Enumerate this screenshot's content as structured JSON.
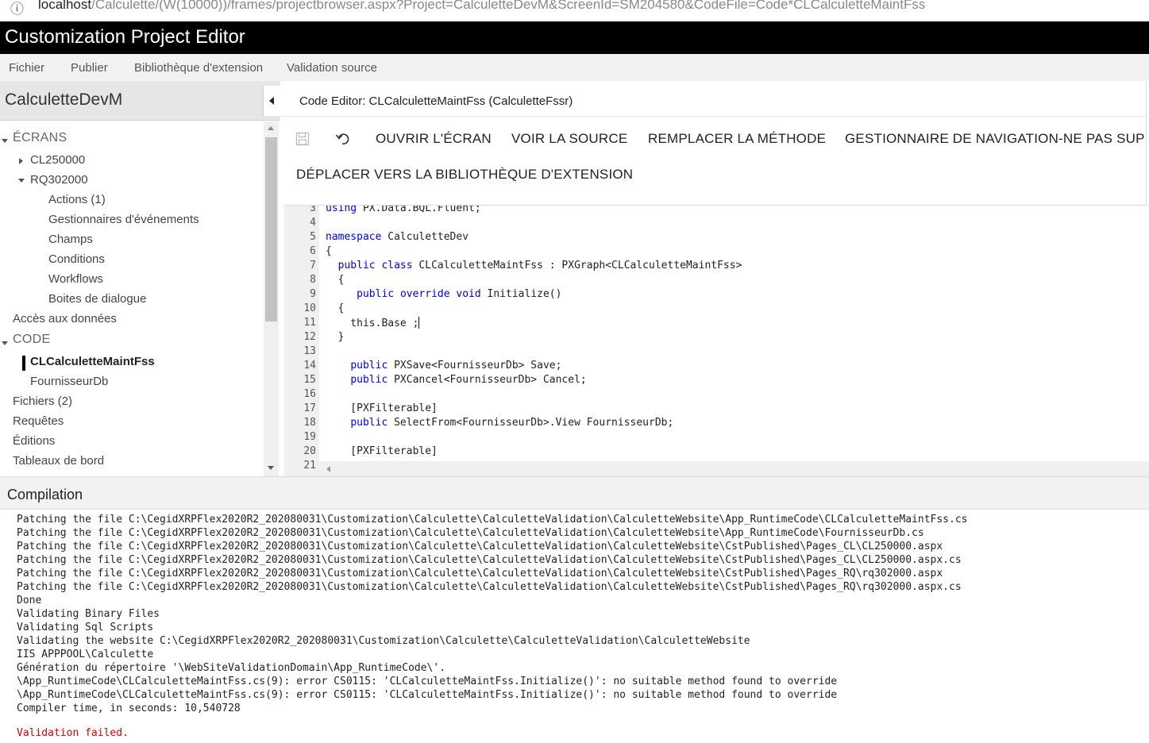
{
  "browser": {
    "info_icon": "info-icon",
    "url_host": "localhost",
    "url_path": "/Calculette/(W(10000))/frames/projectbrowser.aspx?Project=CalculetteDevM&ScreenId=SM204580&CodeFile=Code*CLCalculetteMaintFss"
  },
  "app": {
    "title": "Customization Project Editor"
  },
  "menu": {
    "fichier": "Fichier",
    "publier": "Publier",
    "bibliotheque": "Bibliothèque d'extension",
    "validation": "Validation source"
  },
  "project": {
    "name": "CalculetteDevM"
  },
  "tree": {
    "ecrans": "ÉCRANS",
    "cl250000": "CL250000",
    "rq302000": "RQ302000",
    "actions": "Actions (1)",
    "gestionnaires": "Gestionnaires d'événements",
    "champs": "Champs",
    "conditions": "Conditions",
    "workflows": "Workflows",
    "boites": "Boites de dialogue",
    "acces": "Accès aux données",
    "code": "CODE",
    "clcalc": "CLCalculetteMaintFss",
    "fournisseur": "FournisseurDb",
    "fichiers": "Fichiers (2)",
    "requetes": "Requêtes",
    "editions": "Éditions",
    "tableaux": "Tableaux de bord"
  },
  "editor": {
    "title": "Code Editor: CLCalculetteMaintFss (CalculetteFssr)",
    "toolbar": {
      "save_icon": "save-icon",
      "undo_icon": "undo-icon",
      "ouvrir": "OUVRIR L'ÉCRAN",
      "voir": "VOIR LA SOURCE",
      "remplacer": "REMPLACER LA MÉTHODE",
      "gestionnaire": "GESTIONNAIRE DE NAVIGATION-NE PAS SUPPRIMER",
      "deplacer": "DÉPLACER VERS LA BIBLIOTHÈQUE D'EXTENSION"
    },
    "line_numbers": [
      "3",
      "4",
      "5",
      "6",
      "7",
      "8",
      "9",
      "10",
      "11",
      "12",
      "13",
      "14",
      "15",
      "16",
      "17",
      "18",
      "19",
      "20",
      "21"
    ]
  },
  "compilation": {
    "title": "Compilation",
    "log": [
      "Patching the file C:\\CegidXRPFlex2020R2_202080031\\Customization\\Calculette\\CalculetteValidation\\CalculetteWebsite\\App_RuntimeCode\\CLCalculetteMaintFss.cs",
      "Patching the file C:\\CegidXRPFlex2020R2_202080031\\Customization\\Calculette\\CalculetteValidation\\CalculetteWebsite\\App_RuntimeCode\\FournisseurDb.cs",
      "Patching the file C:\\CegidXRPFlex2020R2_202080031\\Customization\\Calculette\\CalculetteValidation\\CalculetteWebsite\\CstPublished\\Pages_CL\\CL250000.aspx",
      "Patching the file C:\\CegidXRPFlex2020R2_202080031\\Customization\\Calculette\\CalculetteValidation\\CalculetteWebsite\\CstPublished\\Pages_CL\\CL250000.aspx.cs",
      "Patching the file C:\\CegidXRPFlex2020R2_202080031\\Customization\\Calculette\\CalculetteValidation\\CalculetteWebsite\\CstPublished\\Pages_RQ\\rq302000.aspx",
      "Patching the file C:\\CegidXRPFlex2020R2_202080031\\Customization\\Calculette\\CalculetteValidation\\CalculetteWebsite\\CstPublished\\Pages_RQ\\rq302000.aspx.cs",
      "Done",
      "Validating Binary Files",
      "Validating Sql Scripts",
      "Validating the website C:\\CegidXRPFlex2020R2_202080031\\Customization\\Calculette\\CalculetteValidation\\CalculetteWebsite",
      "IIS APPPOOL\\Calculette",
      "Génération du répertoire '\\WebSiteValidationDomain\\App_RuntimeCode\\'.",
      "\\App_RuntimeCode\\CLCalculetteMaintFss.cs(9): error CS0115: 'CLCalculetteMaintFss.Initialize()': no suitable method found to override",
      "\\App_RuntimeCode\\CLCalculetteMaintFss.cs(9): error CS0115: 'CLCalculetteMaintFss.Initialize()': no suitable method found to override",
      "Compiler time, in seconds: 10,540728"
    ],
    "status": "Validation failed.",
    "status_color": "#d40000"
  }
}
